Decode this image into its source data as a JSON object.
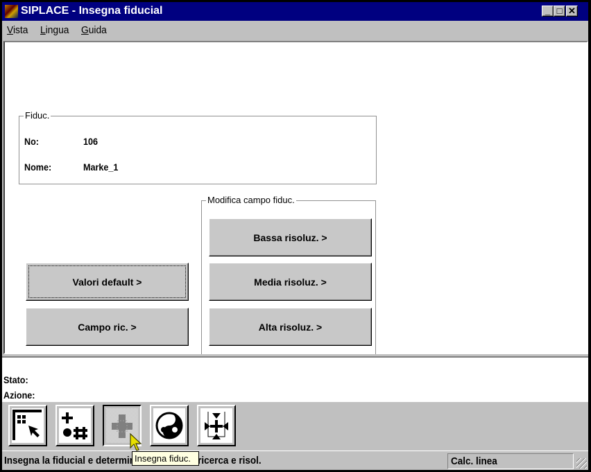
{
  "window": {
    "title": "SIPLACE - Insegna fiducial",
    "minimize": "_",
    "maximize": "□",
    "close": "✕"
  },
  "menu": [
    {
      "label": "Vista"
    },
    {
      "label": "Lingua"
    },
    {
      "label": "Guida"
    }
  ],
  "fiduc": {
    "group_label": "Fiduc.",
    "no_label": "No:",
    "no_value": "106",
    "name_label": "Nome:",
    "name_value": "Marke_1"
  },
  "buttons": {
    "default": "Valori default >",
    "search_field": "Campo ric. >"
  },
  "modify": {
    "group_label": "Modifica campo fiduc.",
    "low": "Bassa risoluz. >",
    "medium": "Media risoluz. >",
    "high": "Alta risoluz. >"
  },
  "info": {
    "state_label": "Stato:",
    "action_label": "Azione:"
  },
  "toolbar": [
    {
      "icon": "select-pointer-icon"
    },
    {
      "icon": "cross-dot-hash-icon"
    },
    {
      "icon": "teach-fiducial-icon",
      "pressed": true
    },
    {
      "icon": "yin-yang-icon"
    },
    {
      "icon": "center-arrows-icon"
    }
  ],
  "tooltip": "Insegna fiduc.",
  "status": {
    "message": "Insegna la fiducial e determina pos. campo ricerca e risol.",
    "panel": "Calc. linea"
  }
}
